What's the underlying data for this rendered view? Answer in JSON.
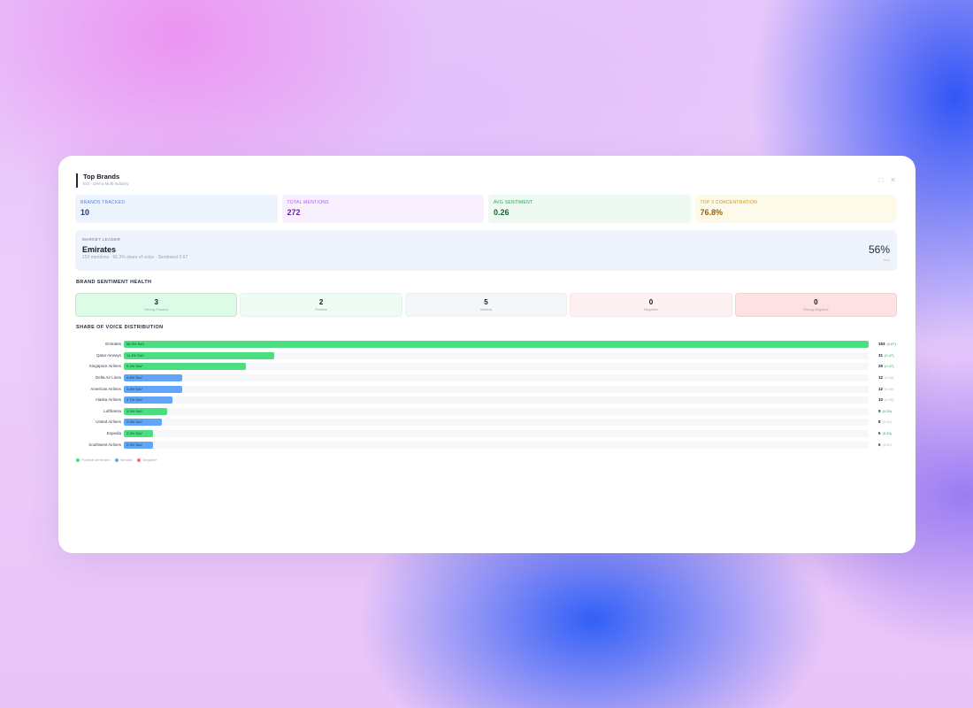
{
  "card": {
    "title": "Top Brands",
    "subtitle": "ESI · Demo Multi-Industry",
    "controls": [
      "□",
      "✕"
    ]
  },
  "stats": [
    {
      "label": "Brands Tracked",
      "value": "10"
    },
    {
      "label": "Total Mentions",
      "value": "272"
    },
    {
      "label": "Avg Sentiment",
      "value": "0.26"
    },
    {
      "label": "Top 3 Concentration",
      "value": "76.8%"
    }
  ],
  "leader": {
    "label": "Market Leader",
    "name": "Emirates",
    "meta": "153 mentions · 56.3% share of voice · Sentiment 0.67",
    "pct": "56%",
    "pct_label": "SoV"
  },
  "health": {
    "title": "Brand Sentiment Health",
    "items": [
      {
        "count": "3",
        "label": "Strong Positive"
      },
      {
        "count": "2",
        "label": "Positive"
      },
      {
        "count": "5",
        "label": "Neutral"
      },
      {
        "count": "0",
        "label": "Negative"
      },
      {
        "count": "0",
        "label": "Strong Negative"
      }
    ]
  },
  "sov": {
    "title": "Share of Voice Distribution",
    "rows": [
      {
        "brand": "Emirates",
        "bar_label": "56.3% SoV",
        "share": 56.3,
        "count": "153",
        "sentiment": "(0.67)",
        "tone": "positive"
      },
      {
        "brand": "Qatar Airways",
        "bar_label": "11.4% SoV",
        "share": 11.4,
        "count": "31",
        "sentiment": "(0.47)",
        "tone": "positive"
      },
      {
        "brand": "Singapore Airlines",
        "bar_label": "9.2% SoV",
        "share": 9.2,
        "count": "25",
        "sentiment": "(0.47)",
        "tone": "positive"
      },
      {
        "brand": "Delta Air Lines",
        "bar_label": "4.4% SoV",
        "share": 4.4,
        "count": "12",
        "sentiment": "(0.00)",
        "tone": "neutral"
      },
      {
        "brand": "American Airlines",
        "bar_label": "4.4% SoV",
        "share": 4.4,
        "count": "12",
        "sentiment": "(0.00)",
        "tone": "neutral"
      },
      {
        "brand": "Alaska Airlines",
        "bar_label": "3.7% SoV",
        "share": 3.7,
        "count": "10",
        "sentiment": "(0.00)",
        "tone": "neutral"
      },
      {
        "brand": "Lufthansa",
        "bar_label": "3.3% SoV",
        "share": 3.3,
        "count": "9",
        "sentiment": "(0.25)",
        "tone": "positive"
      },
      {
        "brand": "United Airlines",
        "bar_label": "2.9% SoV",
        "share": 2.9,
        "count": "8",
        "sentiment": "(0.00)",
        "tone": "neutral"
      },
      {
        "brand": "Expedia",
        "bar_label": "2.2% SoV",
        "share": 2.2,
        "count": "6",
        "sentiment": "(0.33)",
        "tone": "positive"
      },
      {
        "brand": "Southwest Airlines",
        "bar_label": "2.2% SoV",
        "share": 2.2,
        "count": "6",
        "sentiment": "(0.00)",
        "tone": "neutral"
      }
    ],
    "legend": [
      {
        "label": "Positive sentiment",
        "color": "#4ade80"
      },
      {
        "label": "Neutral",
        "color": "#60a5fa"
      },
      {
        "label": "Negative",
        "color": "#f87171"
      }
    ],
    "colors": {
      "positive": "#4ade80",
      "neutral": "#60a5fa",
      "negative": "#f87171"
    },
    "sentiment_text_colors": {
      "positive": "#22a05a",
      "neutral": "#b0b4bb",
      "negative": "#ef4444"
    }
  }
}
